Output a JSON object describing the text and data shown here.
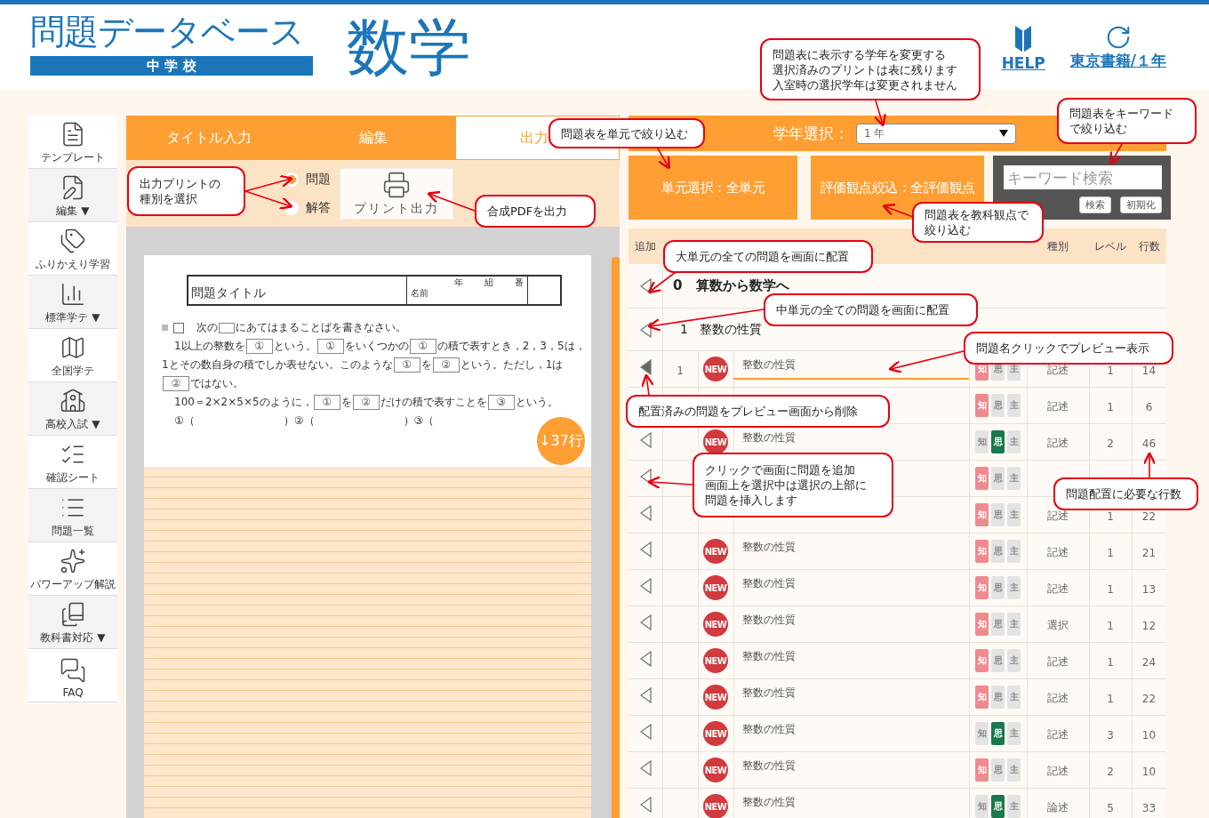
{
  "header": {
    "title": "問題データベース",
    "school": "中 学 校",
    "subject": "数学",
    "help": "HELP",
    "publisher": "東京書籍/１年"
  },
  "sidebar": {
    "items": [
      {
        "label": "テンプレート"
      },
      {
        "label": "編集 ▼"
      },
      {
        "label": "ふりかえり学習"
      },
      {
        "label": "標準学テ ▼"
      },
      {
        "label": "全国学テ"
      },
      {
        "label": "高校入試 ▼"
      },
      {
        "label": "確認シート"
      },
      {
        "label": "問題一覧"
      },
      {
        "label": "パワーアップ解説"
      },
      {
        "label": "教科書対応 ▼"
      },
      {
        "label": "FAQ"
      }
    ]
  },
  "tabs": [
    {
      "label": "タイトル入力",
      "selected": false
    },
    {
      "label": "編集",
      "selected": false
    },
    {
      "label": "出力",
      "selected": true
    }
  ],
  "print_options": {
    "radios": [
      {
        "label": "問題",
        "selected": true
      },
      {
        "label": "解答",
        "selected": false
      }
    ],
    "print_button": "プリント出力"
  },
  "preview": {
    "title": "問題タイトル",
    "name_label": "名前",
    "class_labels": [
      "年",
      "組",
      "番"
    ],
    "line_counter": "↓37行",
    "lines": [
      {
        "indent": false,
        "segments": [
          {
            "kind": "mark"
          },
          {
            "kind": "box"
          },
          {
            "kind": "text",
            "text": "次の"
          },
          {
            "kind": "blank"
          },
          {
            "kind": "text",
            "text": "にあてはまることばを書きなさい。"
          }
        ]
      },
      {
        "indent": true,
        "segments": [
          {
            "kind": "text",
            "text": "1以上の整数を"
          },
          {
            "kind": "blank",
            "text": "①"
          },
          {
            "kind": "text",
            "text": "という。"
          },
          {
            "kind": "blank",
            "text": "①"
          },
          {
            "kind": "text",
            "text": "をいくつかの"
          },
          {
            "kind": "blank",
            "text": "①"
          },
          {
            "kind": "text",
            "text": "の積で表すとき，2，3，5は，"
          }
        ]
      },
      {
        "indent": false,
        "segments": [
          {
            "kind": "text",
            "text": "1とその数自身の積でしか表せない。このような"
          },
          {
            "kind": "blank",
            "text": "①"
          },
          {
            "kind": "text",
            "text": "を"
          },
          {
            "kind": "blank",
            "text": "②"
          },
          {
            "kind": "text",
            "text": "という。ただし，1は"
          }
        ]
      },
      {
        "indent": false,
        "segments": [
          {
            "kind": "blank",
            "text": "②"
          },
          {
            "kind": "text",
            "text": "ではない。"
          }
        ]
      },
      {
        "indent": true,
        "segments": [
          {
            "kind": "text",
            "text": "100＝2×2×5×5のように，"
          },
          {
            "kind": "blank",
            "text": "①"
          },
          {
            "kind": "text",
            "text": "を"
          },
          {
            "kind": "blank",
            "text": "②"
          },
          {
            "kind": "text",
            "text": "だけの積で表すことを"
          },
          {
            "kind": "blank",
            "text": "③"
          },
          {
            "kind": "text",
            "text": "という。"
          }
        ]
      },
      {
        "indent": true,
        "segments": [
          {
            "kind": "text",
            "text": "①（"
          },
          {
            "kind": "gap"
          },
          {
            "kind": "text",
            "text": "）"
          },
          {
            "kind": "text",
            "text": "②（"
          },
          {
            "kind": "gap"
          },
          {
            "kind": "text",
            "text": "）"
          },
          {
            "kind": "text",
            "text": "③（"
          }
        ]
      }
    ]
  },
  "grade": {
    "label": "学年選択：",
    "value": "1 年"
  },
  "filters": {
    "unit": "単元選択：全単元",
    "viewpoint": "評価観点絞込：全評価観点",
    "search": {
      "placeholder": "キーワード検索",
      "buttons": [
        "検索",
        "初期化"
      ]
    }
  },
  "table": {
    "columns": [
      "追加",
      "種別",
      "レベル",
      "行数"
    ],
    "rows": [
      {
        "kind": "major",
        "number": "0",
        "title": "算数から数学へ"
      },
      {
        "kind": "middle",
        "number": "1",
        "title": "整数の性質"
      },
      {
        "kind": "problem",
        "added": true,
        "number": "1",
        "new_label": "NEW",
        "name": "整数の性質",
        "selected": true,
        "badges": [
          {
            "label": "知",
            "on": true
          },
          {
            "label": "思",
            "on": false
          },
          {
            "label": "主",
            "on": false
          }
        ],
        "type": "記述",
        "difficulty": "1",
        "lines": "14"
      },
      {
        "kind": "problem",
        "badges": [
          {
            "label": "知",
            "on": true
          },
          {
            "label": "思",
            "on": false
          },
          {
            "label": "主",
            "on": false
          }
        ],
        "type": "記述",
        "difficulty": "1",
        "lines": "6"
      },
      {
        "kind": "problem",
        "added": false,
        "new_label": "NEW",
        "name": "整数の性質",
        "selected": false,
        "badges": [
          {
            "label": "知",
            "on": false
          },
          {
            "label": "思",
            "on": true
          },
          {
            "label": "主",
            "on": false
          }
        ],
        "type": "記述",
        "difficulty": "2",
        "lines": "46"
      },
      {
        "kind": "problem",
        "added": false,
        "badges": [
          {
            "label": "知",
            "on": true
          },
          {
            "label": "思",
            "on": false
          },
          {
            "label": "主",
            "on": false
          }
        ]
      },
      {
        "kind": "problem",
        "added": false,
        "badges": [
          {
            "label": "知",
            "on": true
          },
          {
            "label": "思",
            "on": false
          },
          {
            "label": "主",
            "on": false
          }
        ],
        "type": "記述",
        "difficulty": "1",
        "lines": "22"
      },
      {
        "kind": "problem",
        "added": false,
        "new_label": "NEW",
        "name": "整数の性質",
        "selected": false,
        "badges": [
          {
            "label": "知",
            "on": true
          },
          {
            "label": "思",
            "on": false
          },
          {
            "label": "主",
            "on": false
          }
        ],
        "type": "記述",
        "difficulty": "1",
        "lines": "21"
      },
      {
        "kind": "problem",
        "added": false,
        "new_label": "NEW",
        "name": "整数の性質",
        "selected": false,
        "badges": [
          {
            "label": "知",
            "on": true
          },
          {
            "label": "思",
            "on": false
          },
          {
            "label": "主",
            "on": false
          }
        ],
        "type": "記述",
        "difficulty": "1",
        "lines": "13"
      },
      {
        "kind": "problem",
        "added": false,
        "new_label": "NEW",
        "name": "整数の性質",
        "selected": false,
        "badges": [
          {
            "label": "知",
            "on": true
          },
          {
            "label": "思",
            "on": false
          },
          {
            "label": "主",
            "on": false
          }
        ],
        "type": "選択",
        "difficulty": "1",
        "lines": "12"
      },
      {
        "kind": "problem",
        "added": false,
        "new_label": "NEW",
        "name": "整数の性質",
        "selected": false,
        "badges": [
          {
            "label": "知",
            "on": true
          },
          {
            "label": "思",
            "on": false
          },
          {
            "label": "主",
            "on": false
          }
        ],
        "type": "記述",
        "difficulty": "1",
        "lines": "24"
      },
      {
        "kind": "problem",
        "added": false,
        "new_label": "NEW",
        "name": "整数の性質",
        "selected": false,
        "badges": [
          {
            "label": "知",
            "on": true
          },
          {
            "label": "思",
            "on": false
          },
          {
            "label": "主",
            "on": false
          }
        ],
        "type": "記述",
        "difficulty": "1",
        "lines": "22"
      },
      {
        "kind": "problem",
        "added": false,
        "new_label": "NEW",
        "name": "整数の性質",
        "selected": false,
        "badges": [
          {
            "label": "知",
            "on": false
          },
          {
            "label": "思",
            "on": true
          },
          {
            "label": "主",
            "on": false
          }
        ],
        "type": "記述",
        "difficulty": "3",
        "lines": "10"
      },
      {
        "kind": "problem",
        "added": false,
        "new_label": "NEW",
        "name": "整数の性質",
        "selected": false,
        "badges": [
          {
            "label": "知",
            "on": true
          },
          {
            "label": "思",
            "on": false
          },
          {
            "label": "主",
            "on": false
          }
        ],
        "type": "記述",
        "difficulty": "2",
        "lines": "10"
      },
      {
        "kind": "problem",
        "added": false,
        "new_label": "NEW",
        "name": "整数の性質",
        "selected": false,
        "badges": [
          {
            "label": "知",
            "on": false
          },
          {
            "label": "思",
            "on": true
          },
          {
            "label": "主",
            "on": false
          }
        ],
        "type": "論述",
        "difficulty": "5",
        "lines": "33"
      }
    ]
  },
  "callouts": [
    {
      "lines": [
        "問題表に表示する学年を変更する",
        "選択済みのプリントは表に残ります",
        "入室時の選択学年は変更されません"
      ]
    },
    {
      "lines": [
        "問題表をキーワード",
        "で絞り込む"
      ]
    },
    {
      "lines": [
        "問題表を単元で絞り込む"
      ]
    },
    {
      "lines": [
        "出力プリントの",
        "種別を選択"
      ]
    },
    {
      "lines": [
        "合成PDFを出力"
      ]
    },
    {
      "lines": [
        "問題表を教科観点で",
        "絞り込む"
      ]
    },
    {
      "lines": [
        "大単元の全ての問題を画面に配置"
      ]
    },
    {
      "lines": [
        "中単元の全ての問題を画面に配置"
      ]
    },
    {
      "lines": [
        "問題名クリックでプレビュー表示"
      ]
    },
    {
      "lines": [
        "配置済みの問題をプレビュー画面から削除"
      ]
    },
    {
      "lines": [
        "クリックで画面に問題を追加",
        "画面上を選択中は選択の上部に",
        "問題を挿入します"
      ]
    },
    {
      "lines": [
        "問題配置に必要な行数"
      ]
    }
  ]
}
